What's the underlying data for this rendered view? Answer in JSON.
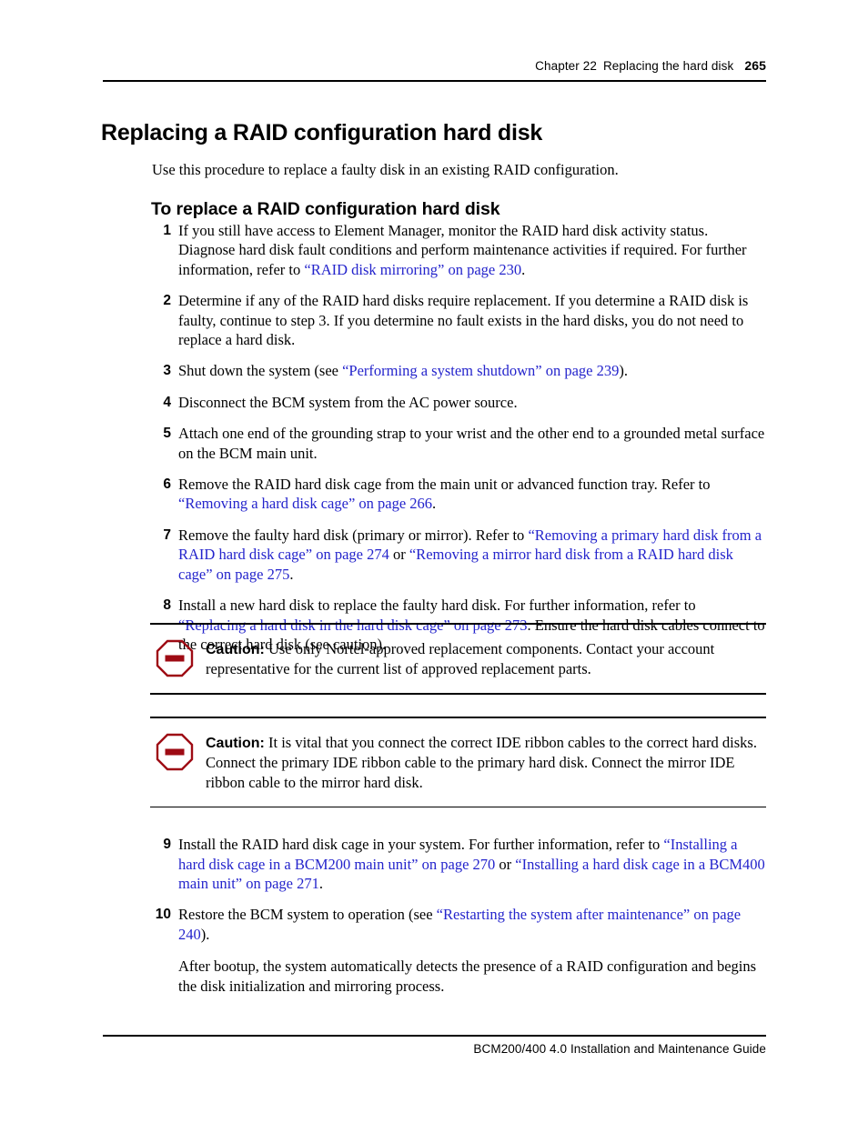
{
  "header": {
    "chapter": "Chapter 22",
    "chapter_title": "Replacing the hard disk",
    "page_number": "265"
  },
  "title": "Replacing a RAID configuration hard disk",
  "intro": "Use this procedure to replace a faulty disk in an existing RAID configuration.",
  "section_heading": "To replace a RAID configuration hard disk",
  "steps": [
    {
      "num": "1",
      "parts": [
        {
          "text": "If you still have access to Element Manager, monitor the RAID hard disk activity status. Diagnose hard disk fault conditions and perform maintenance activities if required. For further information, refer to ",
          "link": false
        },
        {
          "text": "“RAID disk mirroring” on page 230",
          "link": true
        },
        {
          "text": ".",
          "link": false
        }
      ]
    },
    {
      "num": "2",
      "parts": [
        {
          "text": "Determine if any of the RAID hard disks require replacement. If you determine a RAID disk is faulty, continue to step 3. If you determine no fault exists in the hard disks, you do not need to replace a hard disk.",
          "link": false
        }
      ]
    },
    {
      "num": "3",
      "parts": [
        {
          "text": "Shut down the system (see ",
          "link": false
        },
        {
          "text": "“Performing a system shutdown” on page 239",
          "link": true
        },
        {
          "text": ").",
          "link": false
        }
      ]
    },
    {
      "num": "4",
      "parts": [
        {
          "text": "Disconnect the BCM system from the AC power source.",
          "link": false
        }
      ]
    },
    {
      "num": "5",
      "parts": [
        {
          "text": "Attach one end of the grounding strap to your wrist and the other end to a grounded metal surface on the BCM main unit.",
          "link": false
        }
      ]
    },
    {
      "num": "6",
      "parts": [
        {
          "text": "Remove the RAID hard disk cage from the main unit or advanced function tray. Refer to ",
          "link": false
        },
        {
          "text": "“Removing a hard disk cage” on page 266",
          "link": true
        },
        {
          "text": ".",
          "link": false
        }
      ]
    },
    {
      "num": "7",
      "parts": [
        {
          "text": "Remove the faulty hard disk (primary or mirror). Refer to ",
          "link": false
        },
        {
          "text": "“Removing a primary hard disk from a RAID hard disk cage” on page 274",
          "link": true
        },
        {
          "text": " or ",
          "link": false
        },
        {
          "text": "“Removing a mirror hard disk from a RAID hard disk cage” on page 275",
          "link": true
        },
        {
          "text": ".",
          "link": false
        }
      ]
    },
    {
      "num": "8",
      "parts": [
        {
          "text": "Install a new hard disk to replace the faulty hard disk. For further information, refer to ",
          "link": false
        },
        {
          "text": "“Replacing a hard disk in the hard disk cage” on page 273",
          "link": true
        },
        {
          "text": ". Ensure the hard disk cables connect to the correct hard disk (see caution).",
          "link": false
        }
      ]
    }
  ],
  "cautions": [
    {
      "label": "Caution:",
      "text": " Use only Nortel-approved replacement components. Contact your account representative for the current list of approved replacement parts.",
      "icon": "caution-octagon-icon",
      "color": "#9e0b14"
    },
    {
      "label": "Caution:",
      "text": " It is vital that you connect the correct IDE ribbon cables to the correct hard disks. Connect the primary IDE ribbon cable to the primary hard disk. Connect the mirror IDE ribbon cable to the mirror hard disk.",
      "icon": "caution-octagon-icon",
      "color": "#9e0b14"
    }
  ],
  "steps_after": [
    {
      "num": "9",
      "parts": [
        {
          "text": "Install the RAID hard disk cage in your system. For further information, refer to ",
          "link": false
        },
        {
          "text": "“Installing a hard disk cage in a BCM200 main unit” on page 270",
          "link": true
        },
        {
          "text": " or ",
          "link": false
        },
        {
          "text": "“Installing a hard disk cage in a BCM400 main unit” on page 271",
          "link": true
        },
        {
          "text": ".",
          "link": false
        }
      ]
    },
    {
      "num": "10",
      "parts": [
        {
          "text": "Restore the BCM system to operation (see ",
          "link": false
        },
        {
          "text": "“Restarting the system after maintenance” on page 240",
          "link": true
        },
        {
          "text": ").",
          "link": false
        }
      ]
    }
  ],
  "closing_paragraph": "After bootup, the system automatically detects the presence of a RAID configuration and begins the disk initialization and mirroring process.",
  "footer": "BCM200/400 4.0 Installation and Maintenance Guide",
  "colors": {
    "link": "#2424cc",
    "caution": "#9e0b14",
    "text": "#000000"
  }
}
